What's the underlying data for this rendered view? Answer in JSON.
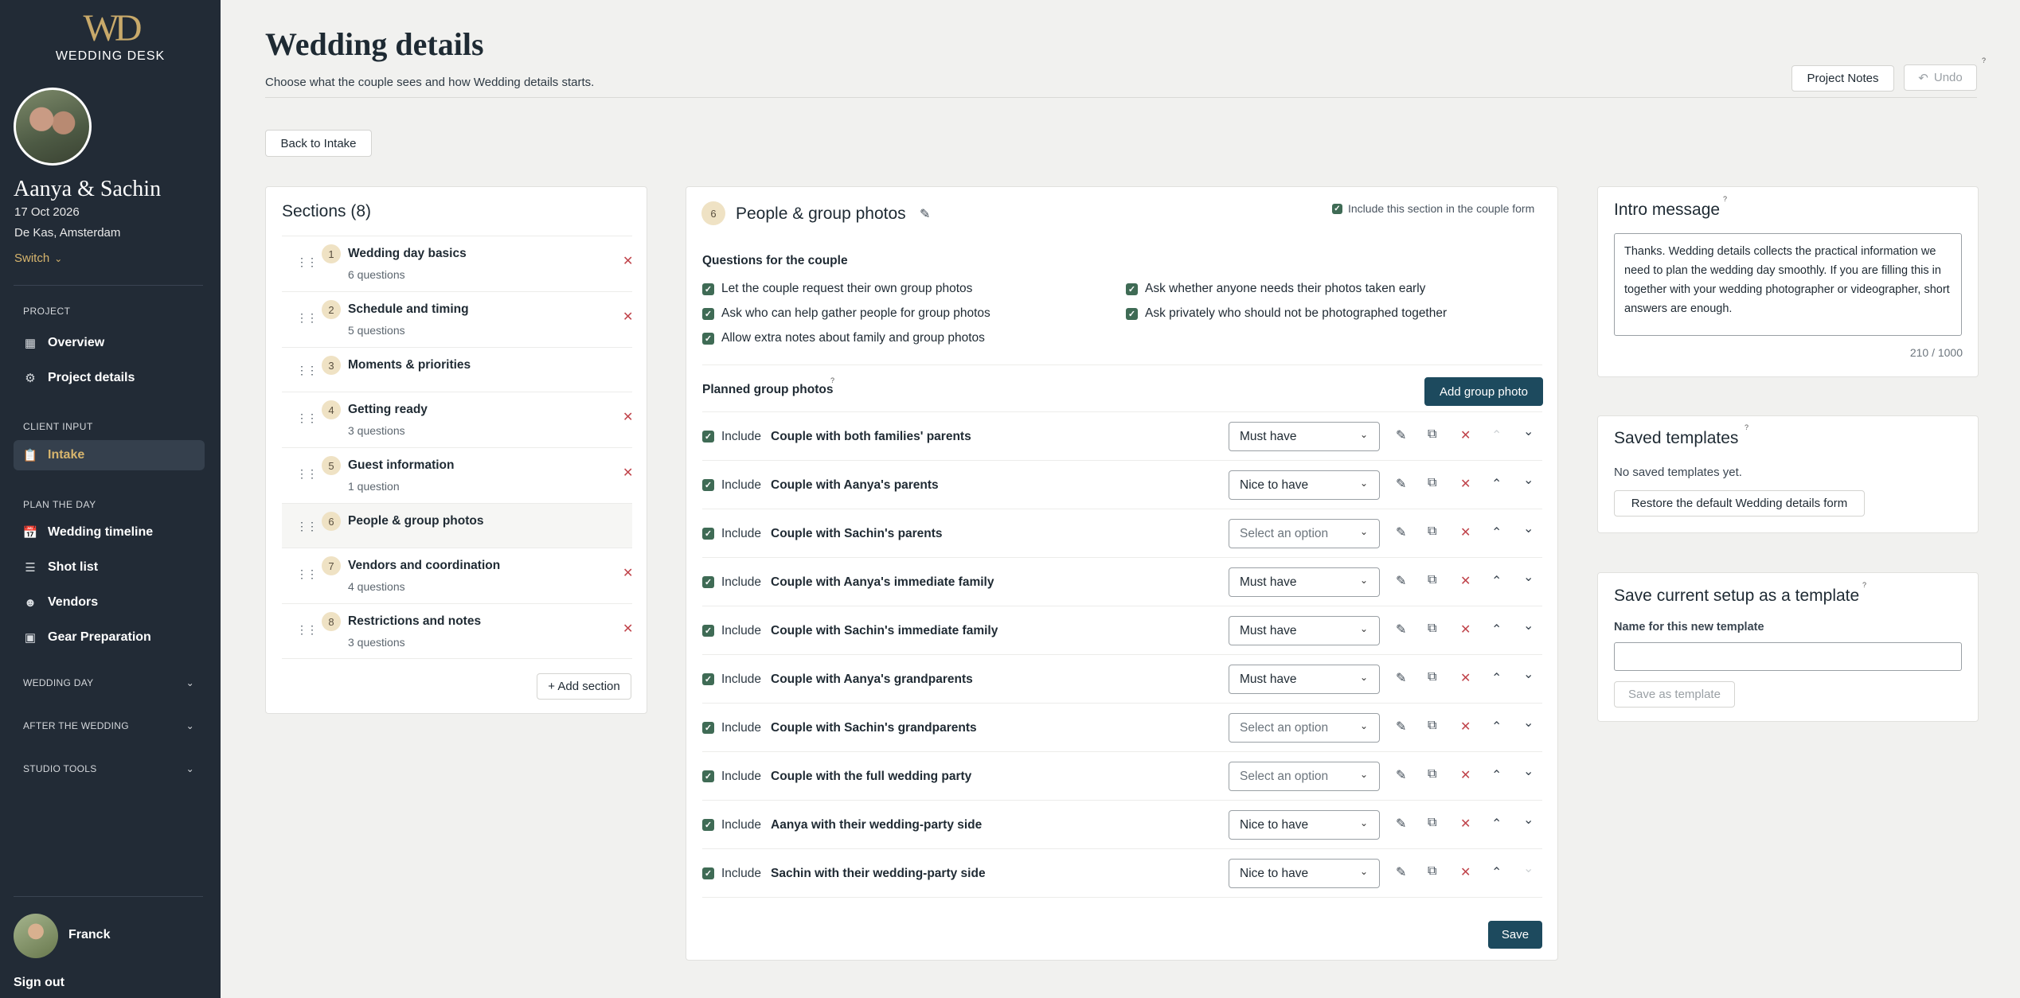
{
  "brand": {
    "mark": "WD",
    "name": "WEDDING DESK"
  },
  "couple": {
    "name": "Aanya & Sachin",
    "date": "17 Oct 2026",
    "venue": "De Kas, Amsterdam",
    "switch": "Switch"
  },
  "nav": {
    "project_head": "PROJECT",
    "overview": "Overview",
    "project_details": "Project details",
    "client_head": "CLIENT INPUT",
    "intake": "Intake",
    "plan_head": "PLAN THE DAY",
    "timeline": "Wedding timeline",
    "shotlist": "Shot list",
    "vendors": "Vendors",
    "gear": "Gear Preparation",
    "group_wedding_day": "WEDDING DAY",
    "group_after": "AFTER THE WEDDING",
    "group_studio": "STUDIO TOOLS"
  },
  "user": {
    "name": "Franck",
    "signout": "Sign out"
  },
  "header": {
    "title": "Wedding details",
    "subtitle": "Choose what the couple sees and how Wedding details starts.",
    "notes": "Project Notes",
    "undo": "Undo",
    "back": "Back to Intake"
  },
  "sections": {
    "title": "Sections (8)",
    "add": "+ Add section",
    "items": [
      {
        "num": "1",
        "name": "Wedding day basics",
        "count": "6 questions"
      },
      {
        "num": "2",
        "name": "Schedule and timing",
        "count": "5 questions"
      },
      {
        "num": "3",
        "name": "Moments & priorities",
        "count": ""
      },
      {
        "num": "4",
        "name": "Getting ready",
        "count": "3 questions"
      },
      {
        "num": "5",
        "name": "Guest information",
        "count": "1 question"
      },
      {
        "num": "6",
        "name": "People & group photos",
        "count": ""
      },
      {
        "num": "7",
        "name": "Vendors and coordination",
        "count": "4 questions"
      },
      {
        "num": "8",
        "name": "Restrictions and notes",
        "count": "3 questions"
      }
    ]
  },
  "editor": {
    "num": "6",
    "title": "People & group photos",
    "include_label": "Include this section in the couple form",
    "questions_title": "Questions for the couple",
    "questions": [
      "Let the couple request their own group photos",
      "Ask who can help gather people for group photos",
      "Allow extra notes about family and group photos",
      "Ask whether anyone needs their photos taken early",
      "Ask privately who should not be photographed together"
    ],
    "planned_title": "Planned group photos",
    "add_button": "Add group photo",
    "include_word": "Include",
    "save": "Save",
    "photos": [
      {
        "name": "Couple with both families' parents",
        "priority": "Must have"
      },
      {
        "name": "Couple with Aanya's parents",
        "priority": "Nice to have"
      },
      {
        "name": "Couple with Sachin's parents",
        "priority": "Select an option"
      },
      {
        "name": "Couple with Aanya's immediate family",
        "priority": "Must have"
      },
      {
        "name": "Couple with Sachin's immediate family",
        "priority": "Must have"
      },
      {
        "name": "Couple with Aanya's grandparents",
        "priority": "Must have"
      },
      {
        "name": "Couple with Sachin's grandparents",
        "priority": "Select an option"
      },
      {
        "name": "Couple with the full wedding party",
        "priority": "Select an option"
      },
      {
        "name": "Aanya with their wedding-party side",
        "priority": "Nice to have"
      },
      {
        "name": "Sachin with their wedding-party side",
        "priority": "Nice to have"
      }
    ]
  },
  "intro": {
    "title": "Intro message",
    "text": "Thanks. Wedding details collects the practical information we need to plan the wedding day smoothly. If you are filling this in together with your wedding photographer or videographer, short answers are enough.",
    "counter": "210 / 1000"
  },
  "saved_templates": {
    "title": "Saved templates",
    "empty": "No saved templates yet.",
    "restore": "Restore the default Wedding details form"
  },
  "save_template": {
    "title": "Save current setup as a template",
    "label": "Name for this new template",
    "value": "",
    "button": "Save as template"
  },
  "colors": {
    "sidebar": "#222b36",
    "accent_gold": "#d7b56d",
    "primary": "#1d4a5e",
    "danger": "#c0444b",
    "check": "#3f6b55"
  }
}
